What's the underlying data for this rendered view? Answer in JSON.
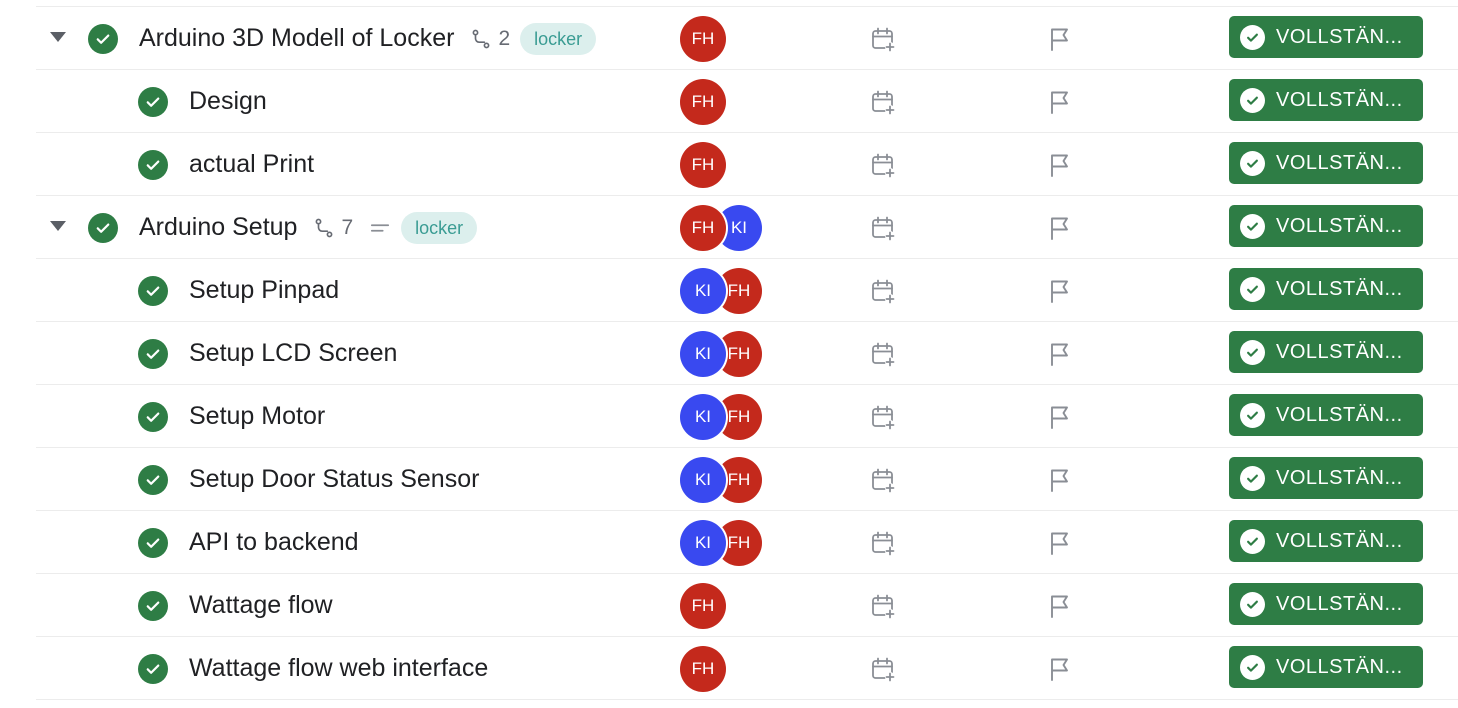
{
  "colors": {
    "status_green": "#2e7d45",
    "avatar_fh": "#c4291c",
    "avatar_ki": "#3949f0",
    "tag_bg": "#dcefed",
    "tag_text": "#3a9c93"
  },
  "icons": {
    "expand": "caret-down-icon",
    "done": "check-circle-icon",
    "subtasks": "subtask-branch-icon",
    "description": "description-lines-icon",
    "date": "calendar-plus-icon",
    "priority": "flag-icon"
  },
  "tasks": [
    {
      "title": "Arduino 3D Modell of Locker",
      "level": 0,
      "expandable": true,
      "subtasks": "2",
      "has_description": false,
      "tag": "locker",
      "assignees": [
        "FH"
      ],
      "status": "VOLLSTÄN..."
    },
    {
      "title": "Design",
      "level": 1,
      "expandable": false,
      "assignees": [
        "FH"
      ],
      "status": "VOLLSTÄN..."
    },
    {
      "title": "actual Print",
      "level": 1,
      "expandable": false,
      "assignees": [
        "FH"
      ],
      "status": "VOLLSTÄN..."
    },
    {
      "title": "Arduino Setup",
      "level": 0,
      "expandable": true,
      "subtasks": "7",
      "has_description": true,
      "tag": "locker",
      "assignees": [
        "FH",
        "KI"
      ],
      "status": "VOLLSTÄN..."
    },
    {
      "title": "Setup Pinpad",
      "level": 1,
      "expandable": false,
      "assignees": [
        "KI",
        "FH"
      ],
      "status": "VOLLSTÄN..."
    },
    {
      "title": "Setup LCD Screen",
      "level": 1,
      "expandable": false,
      "assignees": [
        "KI",
        "FH"
      ],
      "status": "VOLLSTÄN..."
    },
    {
      "title": "Setup Motor",
      "level": 1,
      "expandable": false,
      "assignees": [
        "KI",
        "FH"
      ],
      "status": "VOLLSTÄN..."
    },
    {
      "title": "Setup Door Status Sensor",
      "level": 1,
      "expandable": false,
      "assignees": [
        "KI",
        "FH"
      ],
      "status": "VOLLSTÄN..."
    },
    {
      "title": "API to backend",
      "level": 1,
      "expandable": false,
      "assignees": [
        "KI",
        "FH"
      ],
      "status": "VOLLSTÄN..."
    },
    {
      "title": "Wattage flow",
      "level": 1,
      "expandable": false,
      "assignees": [
        "FH"
      ],
      "status": "VOLLSTÄN..."
    },
    {
      "title": "Wattage flow web interface",
      "level": 1,
      "expandable": false,
      "assignees": [
        "FH"
      ],
      "status": "VOLLSTÄN..."
    }
  ]
}
